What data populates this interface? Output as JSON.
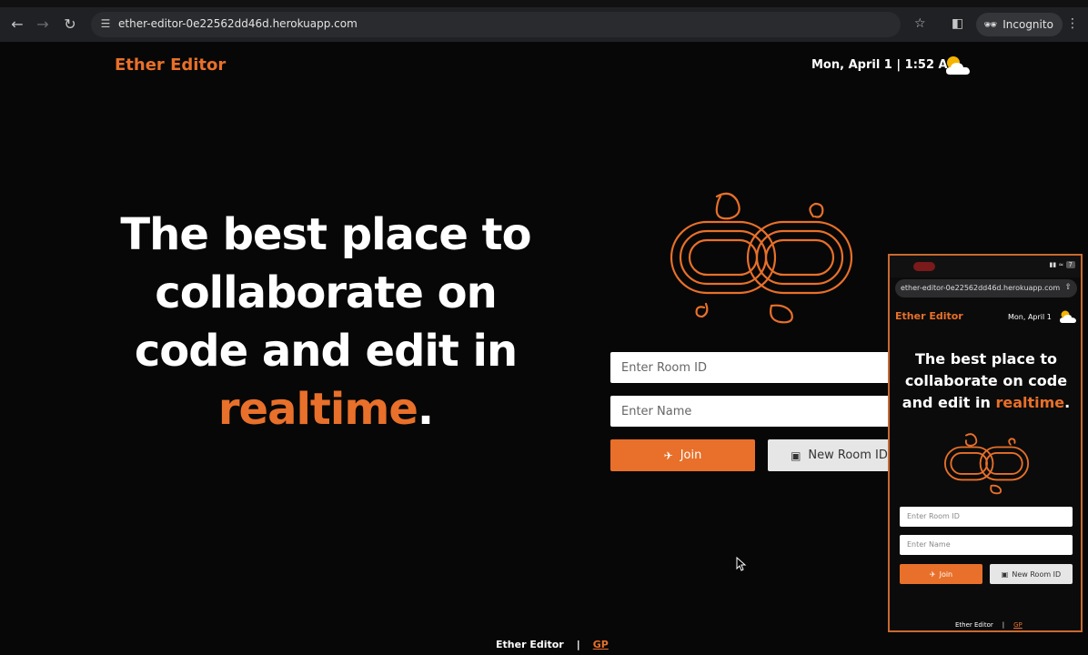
{
  "browser": {
    "url": "ether-editor-0e22562dd46d.herokuapp.com",
    "mode_label": "Incognito"
  },
  "header": {
    "brand": "Ether Editor",
    "datetime": "Mon, April 1 | 1:52 AM"
  },
  "hero": {
    "line1": "The best place to",
    "line2": "collaborate on",
    "line3": "code and edit in",
    "highlight": "realtime",
    "punct": "."
  },
  "form": {
    "room_placeholder": "Enter Room ID",
    "name_placeholder": "Enter Name",
    "join_label": "Join",
    "new_room_label": "New Room ID"
  },
  "footer": {
    "brand": "Ether Editor",
    "sep": "|",
    "link": "GP"
  },
  "phone": {
    "url": "ether-editor-0e22562dd46d.herokuapp.com",
    "battery": "7",
    "brand": "Ether Editor",
    "date": "Mon, April 1",
    "headline_line1": "The best place to",
    "headline_line2": "collaborate on code",
    "headline_line3": "and edit in",
    "highlight": "realtime",
    "punct": ".",
    "room_placeholder": "Enter Room ID",
    "name_placeholder": "Enter Name",
    "join_label": "Join",
    "new_room_label": "New Room ID",
    "footer_brand": "Ether Editor",
    "footer_sep": "|",
    "footer_link": "GP"
  },
  "colors": {
    "accent": "#e8702a",
    "background": "#070707"
  }
}
